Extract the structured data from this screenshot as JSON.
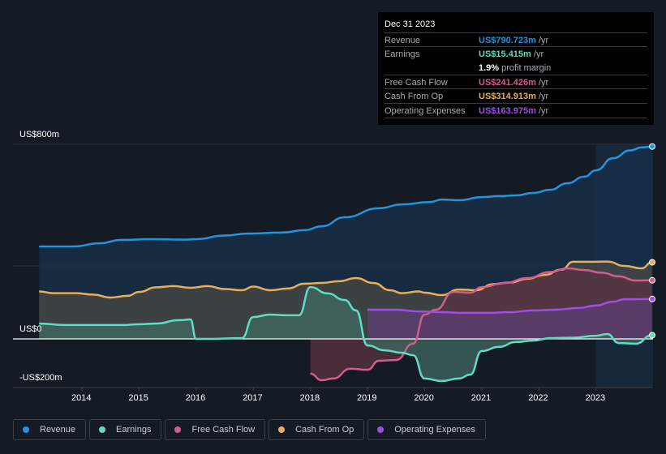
{
  "chart_data": {
    "type": "area",
    "title": "",
    "xlabel": "",
    "ylabel": "",
    "ylim": [
      -200,
      800
    ],
    "xlim": [
      2013.2,
      2024.0
    ],
    "y_tick_labels": [
      {
        "value": 800,
        "label": "US$800m"
      },
      {
        "value": 0,
        "label": "US$0"
      },
      {
        "value": -200,
        "label": "-US$200m"
      }
    ],
    "x_tick_labels": [
      "2014",
      "2015",
      "2016",
      "2017",
      "2018",
      "2019",
      "2020",
      "2021",
      "2022",
      "2023"
    ],
    "x_ticks": [
      2014,
      2015,
      2016,
      2017,
      2018,
      2019,
      2020,
      2021,
      2022,
      2023
    ],
    "gridlines": [
      800,
      300,
      -200
    ],
    "highlight_region": [
      2023.0,
      2024.0
    ],
    "legend_position": "bottom",
    "series": [
      {
        "name": "Revenue",
        "color": "#2394df",
        "fill": "#17304a",
        "points": [
          [
            2013.25,
            380
          ],
          [
            2013.85,
            380
          ],
          [
            2014.3,
            393
          ],
          [
            2014.7,
            407
          ],
          [
            2015.2,
            410
          ],
          [
            2015.8,
            408
          ],
          [
            2016.0,
            410
          ],
          [
            2016.5,
            425
          ],
          [
            2016.9,
            433
          ],
          [
            2017.5,
            437
          ],
          [
            2017.9,
            447
          ],
          [
            2018.2,
            463
          ],
          [
            2018.6,
            500
          ],
          [
            2019.2,
            537
          ],
          [
            2019.6,
            553
          ],
          [
            2020.1,
            563
          ],
          [
            2020.3,
            573
          ],
          [
            2020.6,
            570
          ],
          [
            2021.0,
            583
          ],
          [
            2021.3,
            587
          ],
          [
            2021.6,
            590
          ],
          [
            2021.9,
            600
          ],
          [
            2022.2,
            613
          ],
          [
            2022.5,
            640
          ],
          [
            2022.8,
            667
          ],
          [
            2023.0,
            693
          ],
          [
            2023.3,
            743
          ],
          [
            2023.6,
            775
          ],
          [
            2023.8,
            787
          ],
          [
            2023.98,
            791
          ]
        ]
      },
      {
        "name": "Cash From Op",
        "color": "#e7ae5b",
        "fill": "#4a4a46",
        "points": [
          [
            2013.25,
            195
          ],
          [
            2013.5,
            188
          ],
          [
            2013.9,
            188
          ],
          [
            2014.2,
            182
          ],
          [
            2014.5,
            170
          ],
          [
            2014.8,
            177
          ],
          [
            2015.0,
            193
          ],
          [
            2015.3,
            212
          ],
          [
            2015.6,
            217
          ],
          [
            2015.9,
            210
          ],
          [
            2016.2,
            217
          ],
          [
            2016.5,
            205
          ],
          [
            2016.8,
            200
          ],
          [
            2017.0,
            215
          ],
          [
            2017.3,
            200
          ],
          [
            2017.6,
            207
          ],
          [
            2017.9,
            227
          ],
          [
            2018.2,
            230
          ],
          [
            2018.5,
            237
          ],
          [
            2018.8,
            250
          ],
          [
            2019.1,
            230
          ],
          [
            2019.4,
            200
          ],
          [
            2019.6,
            188
          ],
          [
            2019.9,
            195
          ],
          [
            2020.0,
            190
          ],
          [
            2020.3,
            180
          ],
          [
            2020.6,
            203
          ],
          [
            2020.9,
            200
          ],
          [
            2021.2,
            225
          ],
          [
            2021.5,
            232
          ],
          [
            2021.8,
            247
          ],
          [
            2022.1,
            263
          ],
          [
            2022.4,
            285
          ],
          [
            2022.6,
            317
          ],
          [
            2022.9,
            317
          ],
          [
            2023.2,
            318
          ],
          [
            2023.5,
            300
          ],
          [
            2023.8,
            290
          ],
          [
            2023.98,
            315
          ]
        ]
      },
      {
        "name": "Free Cash Flow",
        "color": "#d25d8c",
        "fill": "#5a3340",
        "points": [
          [
            2018.0,
            -143
          ],
          [
            2018.2,
            -170
          ],
          [
            2018.4,
            -163
          ],
          [
            2018.7,
            -123
          ],
          [
            2019.0,
            -127
          ],
          [
            2019.2,
            -90
          ],
          [
            2019.5,
            -87
          ],
          [
            2019.8,
            -20
          ],
          [
            2020.0,
            100
          ],
          [
            2020.2,
            120
          ],
          [
            2020.5,
            193
          ],
          [
            2020.8,
            190
          ],
          [
            2021.0,
            213
          ],
          [
            2021.4,
            230
          ],
          [
            2021.8,
            250
          ],
          [
            2022.2,
            275
          ],
          [
            2022.5,
            290
          ],
          [
            2022.8,
            283
          ],
          [
            2023.1,
            272
          ],
          [
            2023.4,
            257
          ],
          [
            2023.7,
            240
          ],
          [
            2023.98,
            241
          ]
        ]
      },
      {
        "name": "Operating Expenses",
        "color": "#a24ce8",
        "fill": "#5b3f73",
        "points": [
          [
            2019.0,
            120
          ],
          [
            2019.5,
            120
          ],
          [
            2019.9,
            113
          ],
          [
            2020.3,
            110
          ],
          [
            2020.7,
            107
          ],
          [
            2021.1,
            107
          ],
          [
            2021.5,
            110
          ],
          [
            2021.9,
            117
          ],
          [
            2022.3,
            120
          ],
          [
            2022.7,
            127
          ],
          [
            2023.0,
            137
          ],
          [
            2023.3,
            153
          ],
          [
            2023.5,
            163
          ],
          [
            2023.98,
            164
          ]
        ]
      },
      {
        "name": "Earnings",
        "color": "#5fdcc3",
        "fill": "#3f6a61",
        "points": [
          [
            2013.25,
            63
          ],
          [
            2013.7,
            57
          ],
          [
            2014.2,
            57
          ],
          [
            2014.7,
            57
          ],
          [
            2015.0,
            60
          ],
          [
            2015.3,
            63
          ],
          [
            2015.7,
            77
          ],
          [
            2015.9,
            80
          ],
          [
            2016.0,
            0
          ],
          [
            2016.3,
            0
          ],
          [
            2016.7,
            3
          ],
          [
            2016.8,
            3
          ],
          [
            2017.0,
            90
          ],
          [
            2017.3,
            100
          ],
          [
            2017.6,
            97
          ],
          [
            2017.8,
            97
          ],
          [
            2018.0,
            213
          ],
          [
            2018.3,
            187
          ],
          [
            2018.6,
            160
          ],
          [
            2018.8,
            117
          ],
          [
            2019.0,
            -27
          ],
          [
            2019.3,
            -47
          ],
          [
            2019.6,
            -57
          ],
          [
            2019.8,
            -67
          ],
          [
            2020.0,
            -163
          ],
          [
            2020.3,
            -173
          ],
          [
            2020.6,
            -163
          ],
          [
            2020.8,
            -147
          ],
          [
            2021.0,
            -50
          ],
          [
            2021.3,
            -33
          ],
          [
            2021.6,
            -13
          ],
          [
            2021.9,
            -7
          ],
          [
            2022.2,
            3
          ],
          [
            2022.6,
            5
          ],
          [
            2023.0,
            13
          ],
          [
            2023.2,
            20
          ],
          [
            2023.4,
            -17
          ],
          [
            2023.7,
            -20
          ],
          [
            2023.98,
            15
          ]
        ]
      }
    ]
  },
  "tooltip": {
    "date": "Dec 31 2023",
    "rows": [
      {
        "label": "Revenue",
        "value": "US$790.723m",
        "unit": "/yr",
        "color": "#2394df"
      },
      {
        "label": "Earnings",
        "value": "US$15.415m",
        "unit": "/yr",
        "color": "#5fdcc3"
      },
      {
        "label": "",
        "value": "1.9%",
        "unit": "profit margin",
        "color": "#ffffff"
      },
      {
        "label": "Free Cash Flow",
        "value": "US$241.426m",
        "unit": "/yr",
        "color": "#d25d8c"
      },
      {
        "label": "Cash From Op",
        "value": "US$314.913m",
        "unit": "/yr",
        "color": "#e7ae5b"
      },
      {
        "label": "Operating Expenses",
        "value": "US$163.975m",
        "unit": "/yr",
        "color": "#a24ce8"
      }
    ]
  },
  "legend": [
    {
      "label": "Revenue",
      "color": "#2394df"
    },
    {
      "label": "Earnings",
      "color": "#5fdcc3"
    },
    {
      "label": "Free Cash Flow",
      "color": "#d25d8c"
    },
    {
      "label": "Cash From Op",
      "color": "#e7ae5b"
    },
    {
      "label": "Operating Expenses",
      "color": "#a24ce8"
    }
  ]
}
